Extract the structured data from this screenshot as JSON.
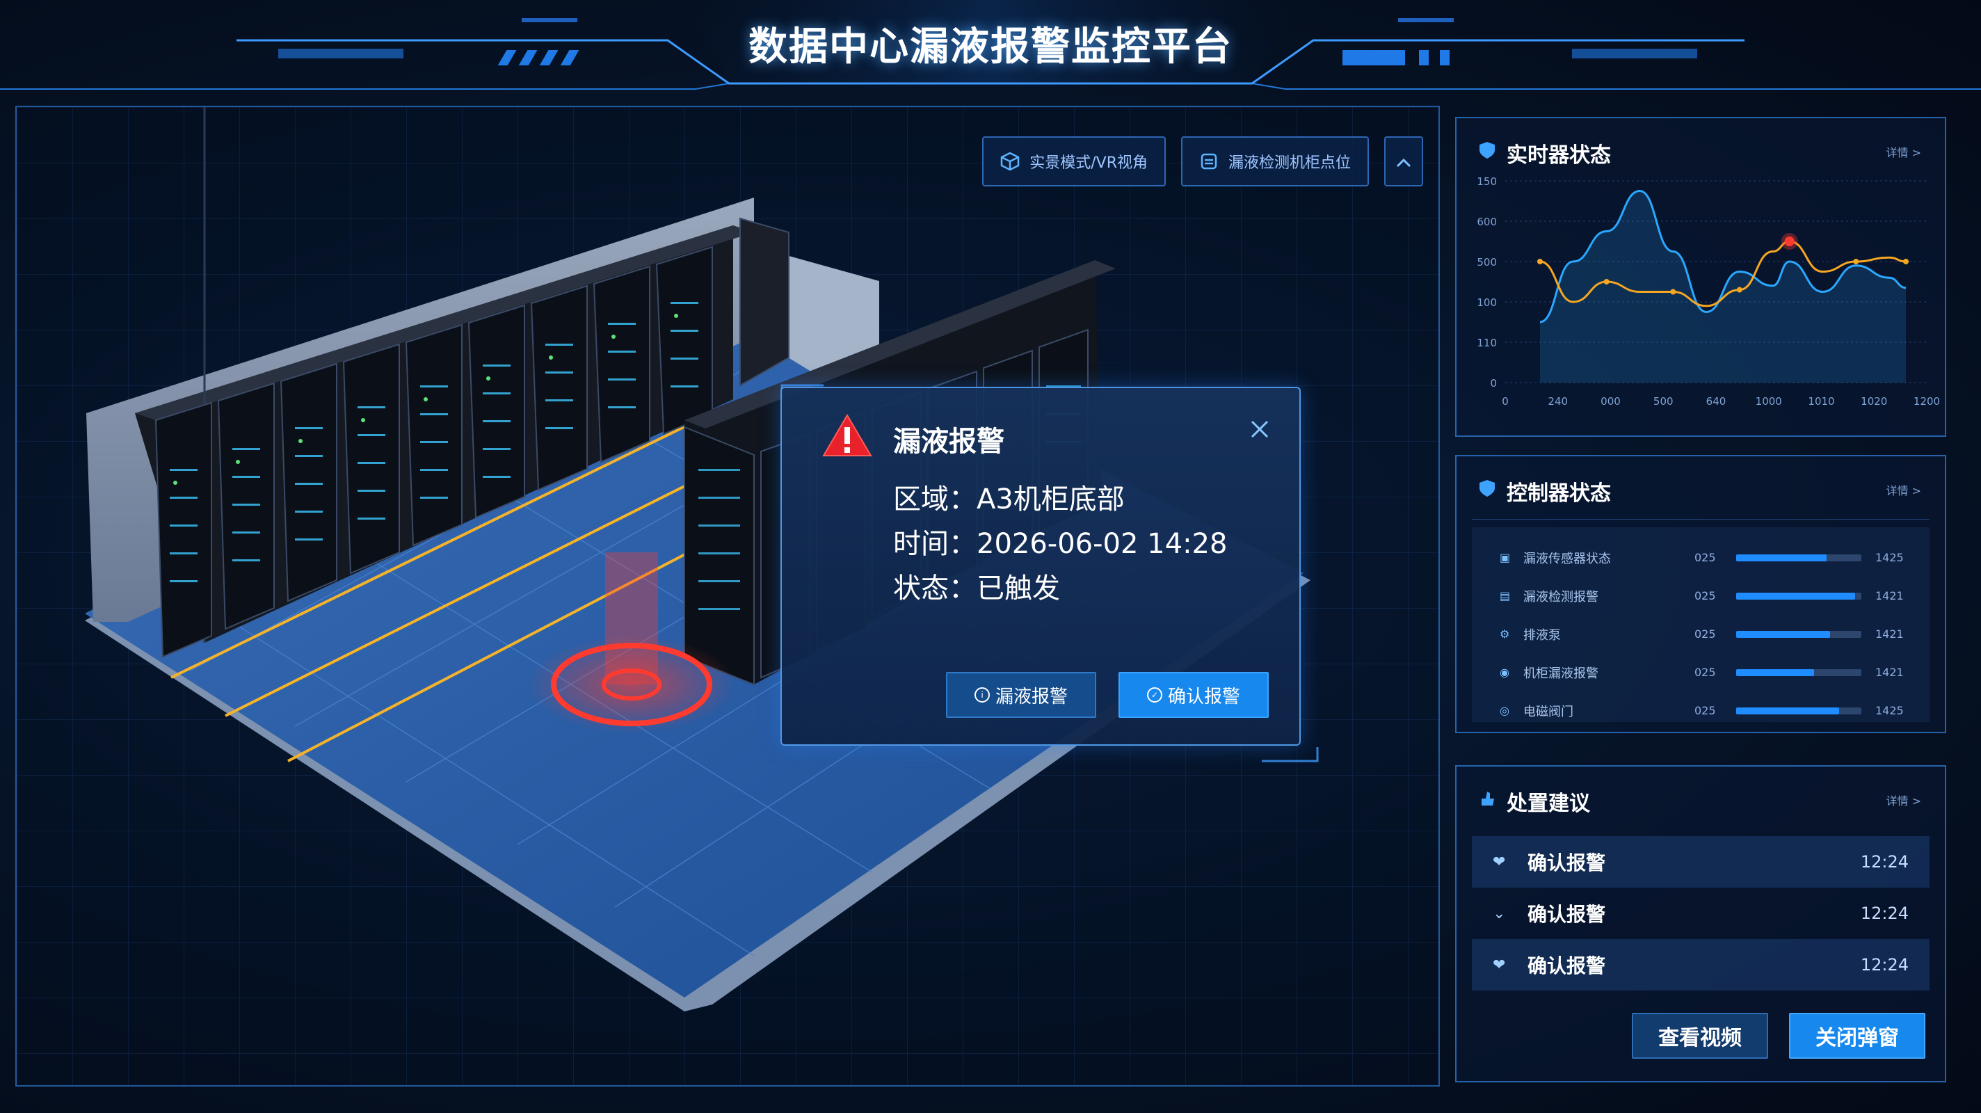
{
  "header": {
    "title": "数据中心漏液报警监控平台"
  },
  "scene_toolbar": {
    "btn1_label": "实景模式/VR视角",
    "btn2_label": "漏液检测机柜点位",
    "collapse_icon": "chevron-up-icon"
  },
  "alarm": {
    "title": "漏液报警",
    "area": "区域：A3机柜底部",
    "time": "时间：2026-06-02 14:28",
    "status": "状态：已触发",
    "btn_secondary": "漏液报警",
    "btn_primary": "确认报警",
    "warning_color": "#e8212b"
  },
  "chart_panel": {
    "title": "实时器状态",
    "more": "详情 >",
    "chart_data": {
      "type": "line",
      "title": "",
      "xlabel": "",
      "ylabel": "",
      "x_ticks": [
        "0",
        "240",
        "000",
        "500",
        "640",
        "1000",
        "1010",
        "1020",
        "1200"
      ],
      "y_ticks": [
        "0",
        "110",
        "100",
        "500",
        "600",
        "150"
      ],
      "series": [
        {
          "color": "#2aa8ff",
          "points": [
            [
              0,
              0.3
            ],
            [
              40,
              0.6
            ],
            [
              80,
              0.75
            ],
            [
              120,
              0.95
            ],
            [
              160,
              0.65
            ],
            [
              200,
              0.35
            ],
            [
              240,
              0.55
            ],
            [
              280,
              0.48
            ],
            [
              300,
              0.6
            ],
            [
              340,
              0.45
            ],
            [
              380,
              0.58
            ],
            [
              420,
              0.52
            ],
            [
              440,
              0.47
            ]
          ]
        },
        {
          "color": "#f5a623",
          "points": [
            [
              0,
              0.6
            ],
            [
              40,
              0.4
            ],
            [
              80,
              0.5
            ],
            [
              120,
              0.45
            ],
            [
              160,
              0.45
            ],
            [
              200,
              0.38
            ],
            [
              240,
              0.46
            ],
            [
              280,
              0.65
            ],
            [
              300,
              0.7
            ],
            [
              340,
              0.55
            ],
            [
              380,
              0.6
            ],
            [
              420,
              0.62
            ],
            [
              440,
              0.6
            ]
          ]
        }
      ],
      "alarm_marker_color": "#ff3b30"
    }
  },
  "ctrl_panel": {
    "title": "控制器状态",
    "more": "详情 >",
    "items": [
      {
        "icon": "sensor-icon",
        "name": "漏液传感器状态",
        "value": "025",
        "fill": 0.72,
        "time": "1425"
      },
      {
        "icon": "alarm-icon",
        "name": "漏液检测报警",
        "value": "025",
        "fill": 0.95,
        "time": "1421"
      },
      {
        "icon": "gear-icon",
        "name": "排液泵",
        "value": "025",
        "fill": 0.75,
        "time": "1421"
      },
      {
        "icon": "location-icon",
        "name": "机柜漏液报警",
        "value": "025",
        "fill": 0.62,
        "time": "1421"
      },
      {
        "icon": "valve-icon",
        "name": "电磁阀门",
        "value": "025",
        "fill": 0.82,
        "time": "1425"
      }
    ]
  },
  "adv_panel": {
    "title": "处置建议",
    "more": "详情 >",
    "items": [
      {
        "name": "确认报警",
        "time": "12:24"
      },
      {
        "name": "确认报警",
        "time": "12:24"
      },
      {
        "name": "确认报警",
        "time": "12:24"
      }
    ],
    "btn_video": "查看视频",
    "btn_close": "关闭弹窗"
  }
}
